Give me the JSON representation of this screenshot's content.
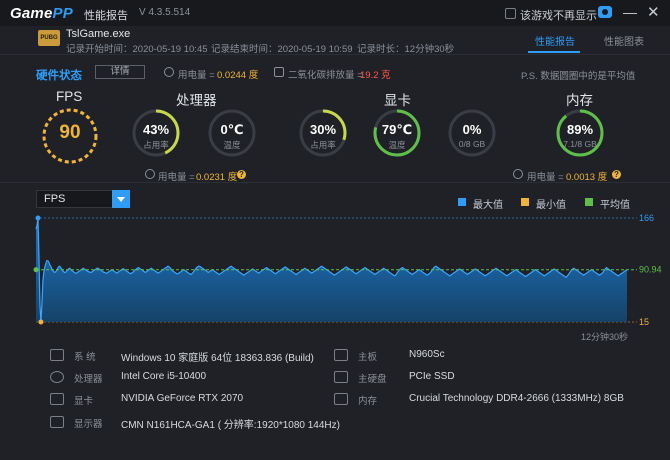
{
  "titlebar": {
    "logo_a": "Game",
    "logo_b": "PP",
    "title": "性能报告",
    "version": "V 4.3.5.514",
    "checkbox_label": "该游戏不再显示",
    "minimize": "—",
    "close": "✕"
  },
  "game": {
    "icon_text": "PUBG",
    "name": "TslGame.exe",
    "start": "记录开始时间：2020-05-19 10:45",
    "end": "记录结束时间：2020-05-19 10:59",
    "duration": "记录时长：12分钟30秒"
  },
  "tabs": [
    {
      "label": "性能报告",
      "active": true
    },
    {
      "label": "性能图表",
      "active": false
    }
  ],
  "hardware": {
    "title": "硬件状态",
    "detail_button": "详情",
    "power_label": "用电量 =",
    "power_value": "0.0244 度",
    "co2_label": "二氧化碳排放量 =",
    "co2_value": "19.2 克",
    "note": "P.S. 数据圆圈中的是平均值"
  },
  "sections": {
    "fps": "FPS",
    "cpu": "处理器",
    "gpu": "显卡",
    "mem": "内存"
  },
  "fps_value": "90",
  "gauges": {
    "cpu_usage": {
      "value": "43%",
      "sub": "占用率",
      "fraction": 0.43,
      "color": "#c8d84a"
    },
    "cpu_temp": {
      "value": "0℃",
      "sub": "温度",
      "fraction": 0.0,
      "color": "#c8d84a"
    },
    "gpu_usage": {
      "value": "30%",
      "sub": "占用率",
      "fraction": 0.3,
      "color": "#c8d84a"
    },
    "gpu_temp": {
      "value": "79℃",
      "sub": "温度",
      "fraction": 0.79,
      "color": "#5fbf4a"
    },
    "gpu_mem": {
      "value": "0%",
      "sub": "0/8 GB",
      "fraction": 0.0,
      "color": "#5fbf4a"
    },
    "mem_usage": {
      "value": "89%",
      "sub": "7.1/8 GB",
      "fraction": 0.89,
      "color": "#5fbf4a"
    }
  },
  "cpu_power": {
    "label": "用电量 =",
    "value": "0.0231 度"
  },
  "mem_power": {
    "label": "用电量 =",
    "value": "0.0013 度"
  },
  "help_glyph": "?",
  "chart_controls": {
    "selected": "FPS",
    "legend": [
      {
        "label": "最大值",
        "color": "#2f9cf5"
      },
      {
        "label": "最小值",
        "color": "#f0b43a"
      },
      {
        "label": "平均值",
        "color": "#5fbf4a"
      }
    ]
  },
  "chart_data": {
    "type": "area",
    "series": [
      {
        "values": [
          150,
          155,
          166,
          110,
          40,
          15,
          40,
          75,
          88,
          95,
          100,
          104,
          104,
          102,
          98,
          96,
          92,
          90,
          88,
          87,
          88,
          90,
          93,
          95,
          96,
          94,
          92,
          90,
          88,
          87,
          87,
          89,
          90,
          92,
          93,
          92,
          90,
          89,
          88,
          87,
          86,
          86,
          87,
          88,
          89,
          90,
          91,
          92,
          93,
          92,
          91,
          90,
          89,
          88,
          88,
          87,
          87,
          88,
          89,
          90,
          91,
          92,
          93,
          93,
          92,
          91,
          90,
          89,
          88,
          87,
          87,
          86,
          86,
          87,
          88,
          89,
          90,
          91,
          90,
          89,
          88,
          87,
          86,
          87,
          88,
          89,
          90,
          91,
          92,
          92,
          91,
          90,
          89,
          88,
          87,
          86,
          85,
          86,
          87,
          88,
          90,
          91,
          92,
          93,
          94,
          93,
          92,
          91,
          90,
          89,
          88,
          87,
          88,
          89,
          90,
          91,
          92,
          93,
          92,
          91,
          90,
          89,
          88,
          87,
          86,
          87,
          88,
          89,
          90,
          91,
          92,
          93,
          94,
          95,
          96,
          95,
          94,
          92,
          90,
          89,
          88,
          87,
          86,
          85,
          85,
          86,
          87,
          88,
          89,
          90,
          91,
          90,
          89,
          88,
          87,
          86,
          85,
          84,
          85,
          86,
          88,
          90,
          92,
          94,
          95,
          96,
          96,
          95,
          94,
          93,
          92,
          91,
          90,
          89,
          88,
          87,
          88,
          89,
          90,
          91,
          90,
          89,
          88,
          87,
          86,
          85,
          84,
          85,
          86,
          87,
          88,
          89,
          90,
          91,
          92,
          93,
          94,
          95,
          96,
          95,
          94,
          93,
          92,
          91,
          90,
          89,
          88,
          87,
          86,
          85,
          84,
          83,
          84,
          85,
          86,
          87,
          88,
          89,
          90,
          91,
          92,
          91,
          90,
          89,
          88,
          87,
          86,
          87,
          88,
          89,
          90,
          91,
          92,
          93,
          94,
          93,
          92,
          91,
          90,
          89,
          88,
          87,
          86,
          85,
          86,
          87,
          88,
          89,
          90,
          91,
          92,
          93,
          94,
          95,
          94,
          93,
          92,
          91,
          90,
          89,
          88,
          87,
          86,
          85,
          84,
          85,
          86,
          87,
          88,
          89,
          90,
          91,
          92,
          93,
          92,
          91,
          90,
          89,
          88,
          87,
          86,
          87,
          88,
          89,
          90,
          91,
          92,
          93,
          94,
          95,
          96,
          95,
          94,
          93,
          92,
          91,
          90,
          89,
          88,
          87,
          86,
          85,
          84,
          83,
          84,
          85,
          86,
          87,
          88,
          89,
          90,
          91,
          92,
          93,
          94,
          95,
          94,
          93,
          92,
          91,
          90,
          89,
          88,
          87,
          86,
          85,
          86,
          87,
          88,
          89,
          90,
          91,
          92,
          93,
          94,
          93,
          92,
          91,
          90,
          89,
          88,
          87,
          86,
          85,
          84,
          85,
          86,
          87,
          88,
          89,
          90,
          91,
          92,
          93,
          92,
          91,
          90,
          89,
          88,
          87,
          86,
          85,
          84,
          83,
          82,
          83,
          85,
          87,
          89,
          91,
          92,
          93,
          94,
          93,
          92,
          91,
          90,
          89,
          88,
          87,
          86,
          85,
          84,
          85,
          86,
          87,
          88,
          89,
          90,
          91,
          90,
          89,
          88,
          87,
          86,
          85,
          84,
          83,
          84,
          85,
          86,
          88,
          90,
          92,
          94,
          95,
          96,
          95,
          94,
          93,
          92,
          91,
          90,
          89,
          88,
          87,
          86,
          85,
          84,
          83,
          82,
          83,
          84,
          85,
          86,
          87,
          88,
          89,
          90,
          91,
          92,
          91,
          90,
          89,
          88,
          87,
          86,
          85,
          84,
          85,
          86,
          87,
          88,
          89,
          90,
          91,
          92,
          91,
          90,
          89,
          88,
          87,
          86,
          85,
          84,
          83,
          82,
          83,
          84,
          85,
          86,
          87,
          88,
          89,
          90,
          91,
          92,
          93,
          92,
          91,
          90,
          89,
          88,
          87,
          86,
          85,
          84,
          83,
          82,
          83,
          84,
          85,
          86,
          87,
          88,
          89,
          90,
          91,
          90,
          89,
          88,
          87,
          86,
          85,
          84,
          83,
          82,
          81,
          82,
          83,
          84,
          85,
          86,
          87,
          88,
          89,
          90,
          91,
          90,
          89,
          88,
          87,
          86,
          85,
          84,
          83,
          82,
          83,
          84,
          85,
          86,
          87,
          88,
          89,
          90,
          91,
          92,
          91,
          90,
          89,
          88,
          87,
          86,
          85,
          84,
          83,
          82,
          81,
          80,
          81,
          83,
          85,
          87,
          89,
          91,
          92,
          93,
          92,
          91,
          90,
          89,
          88,
          87,
          86,
          85,
          84,
          83,
          84,
          85,
          86,
          87,
          88,
          89,
          90,
          91,
          90,
          89,
          88,
          87,
          86,
          85,
          84,
          83,
          84,
          85,
          86,
          88,
          90,
          92,
          94,
          93,
          92,
          91,
          90,
          89,
          88,
          87,
          86,
          85,
          84,
          83,
          82,
          83,
          84,
          85,
          86,
          87,
          88,
          89,
          90,
          91
        ]
      }
    ],
    "ylim": [
      15,
      166
    ],
    "max": 166,
    "min": 15,
    "avg": 90.94,
    "y_tick_labels": [
      "166",
      "90.94",
      "15"
    ],
    "x_end_label": "12分钟30秒"
  },
  "sysinfo": [
    {
      "icon": "monitor-icon",
      "label": "系 统",
      "value": "Windows 10 家庭版 64位  18363.836 (Build)"
    },
    {
      "icon": "chip-icon",
      "label": "处理器",
      "value": "Intel Core i5-10400"
    },
    {
      "icon": "gpu-icon",
      "label": "显卡",
      "value": "NVIDIA GeForce RTX 2070"
    },
    {
      "icon": "display-icon",
      "label": "显示器",
      "value": "CMN N161HCA-GA1 ( 分辨率:1920*1080 144Hz)"
    },
    {
      "icon": "motherboard-icon",
      "label": "主板",
      "value": "N960Sc"
    },
    {
      "icon": "disk-icon",
      "label": "主硬盘",
      "value": "PCIe SSD"
    },
    {
      "icon": "memory-icon",
      "label": "内存",
      "value": "Crucial Technology DDR4-2666 (1333MHz) 8GB"
    }
  ]
}
